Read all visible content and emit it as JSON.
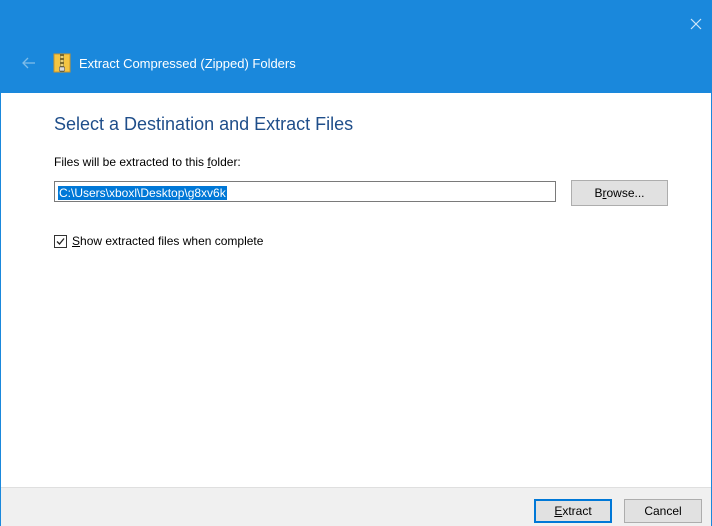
{
  "window": {
    "title": "Extract Compressed (Zipped) Folders",
    "accent_color": "#1a88dc"
  },
  "titlebar": {
    "back_icon": "back-arrow-icon",
    "app_icon": "zip-folder-icon",
    "close_icon": "close-icon"
  },
  "main": {
    "heading": "Select a Destination and Extract Files",
    "label_pre": "Files will be extracted to this ",
    "label_underlined": "f",
    "label_post": "older:",
    "path_value": "C:\\Users\\xboxl\\Desktop\\g8xv6k",
    "browse_pre": "B",
    "browse_underlined": "r",
    "browse_post": "owse...",
    "checkbox_checked": true,
    "checkbox_label_underlined": "S",
    "checkbox_label_post": "how extracted files when complete"
  },
  "footer": {
    "extract_underlined": "E",
    "extract_post": "xtract",
    "cancel_label": "Cancel"
  }
}
